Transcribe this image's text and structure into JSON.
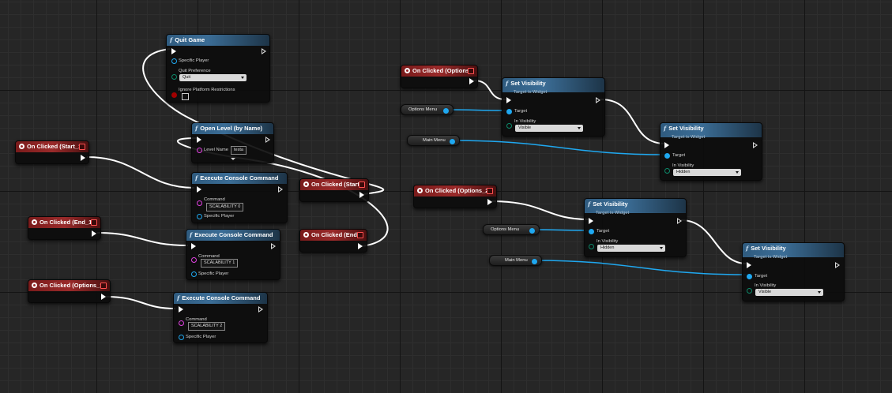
{
  "nodes": {
    "quit_game": {
      "title": "Quit Game",
      "specific_player": "Specific Player",
      "quit_pref_label": "Quit Preference",
      "quit_pref_value": "Quit",
      "ignore_restrictions": "Ignore Platform Restrictions"
    },
    "open_level": {
      "title": "Open Level (by Name)",
      "level_name_label": "Level Name",
      "level_name_value": "testa"
    },
    "exec_cmd_1": {
      "title": "Execute Console Command",
      "command_label": "Command",
      "command_value": "SCALABILITY 0",
      "player_label": "Specific Player"
    },
    "exec_cmd_2": {
      "title": "Execute Console Command",
      "command_label": "Command",
      "command_value": "SCALABILITY 1",
      "player_label": "Specific Player"
    },
    "exec_cmd_3": {
      "title": "Execute Console Command",
      "command_label": "Command",
      "command_value": "SCALABILITY 2",
      "player_label": "Specific Player"
    },
    "ev_start_1": {
      "title": "On Clicked (Start_1)"
    },
    "ev_end_1": {
      "title": "On Clicked (End_1)"
    },
    "ev_options_1": {
      "title": "On Clicked (Options_1)"
    },
    "ev_start": {
      "title": "On Clicked (Start)"
    },
    "ev_end": {
      "title": "On Clicked (End)"
    },
    "ev_options": {
      "title": "On Clicked (Options)"
    },
    "ev_options_2": {
      "title": "On Clicked (Options_2)"
    },
    "setvis_1": {
      "title": "Set Visibility",
      "subtitle": "Target is Widget",
      "target_label": "Target",
      "vis_label": "In Visibility",
      "vis_value": "Visible"
    },
    "setvis_2": {
      "title": "Set Visibility",
      "subtitle": "Target is Widget",
      "target_label": "Target",
      "vis_label": "In Visibility",
      "vis_value": "Hidden"
    },
    "setvis_3": {
      "title": "Set Visibility",
      "subtitle": "Target is Widget",
      "target_label": "Target",
      "vis_label": "In Visibility",
      "vis_value": "Hidden"
    },
    "setvis_4": {
      "title": "Set Visibility",
      "subtitle": "Target is Widget",
      "target_label": "Target",
      "vis_label": "In Visibility",
      "vis_value": "Visible"
    }
  },
  "variables": {
    "options_menu_1": "Options Menu",
    "main_menu_1": "Main Menu",
    "options_menu_2": "Options Menu",
    "main_menu_2": "Main Menu"
  },
  "colors": {
    "exec_wire": "#ffffff",
    "object_wire": "#1fa8f0",
    "function_header": "#3b6d96",
    "event_header": "#9a2a2a"
  }
}
